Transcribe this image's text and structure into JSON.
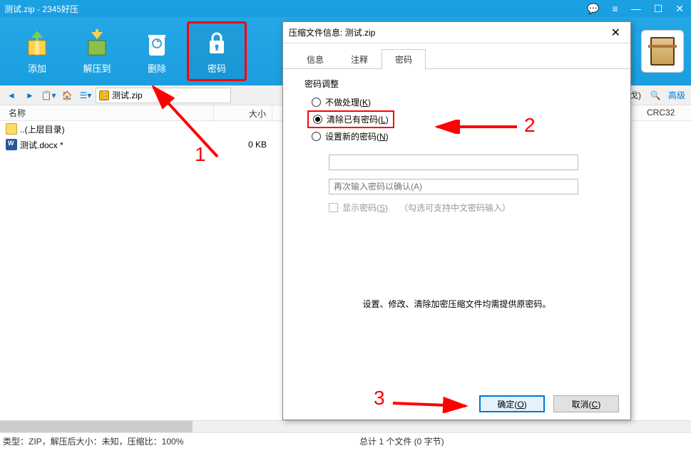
{
  "titlebar": {
    "title": "测试.zip - 2345好压"
  },
  "toolbar": {
    "add": "添加",
    "extract": "解压到",
    "delete": "删除",
    "password": "密码"
  },
  "nav": {
    "path": "测试.zip",
    "compressed_label": "戈)",
    "more": "高级"
  },
  "columns": {
    "name": "名称",
    "size": "大小",
    "crc": "CRC32"
  },
  "rows": {
    "up": "..(上层目录)",
    "file": "测试.docx *",
    "file_size": "0 KB"
  },
  "status": {
    "left": "类型：ZIP，解压后大小：未知，压缩比：100%",
    "mid": "总计 1 个文件 (0 字节)"
  },
  "dialog": {
    "title": "压缩文件信息: 测试.zip",
    "tabs": {
      "info": "信息",
      "comment": "注释",
      "pwd": "密码"
    },
    "group": "密码调整",
    "opt_none": "不做处理(K)",
    "opt_clear": "清除已有密码(L)",
    "opt_set": "设置新的密码(N)",
    "placeholder_confirm": "再次输入密码以确认(A)",
    "show_pwd": "显示密码(S)",
    "show_hint": "（勾选可支持中文密码输入）",
    "note": "设置、修改、清除加密压缩文件均需提供原密码。",
    "ok": "确定(O)",
    "cancel": "取消(C)"
  },
  "annotations": {
    "n1": "1",
    "n2": "2",
    "n3": "3"
  }
}
